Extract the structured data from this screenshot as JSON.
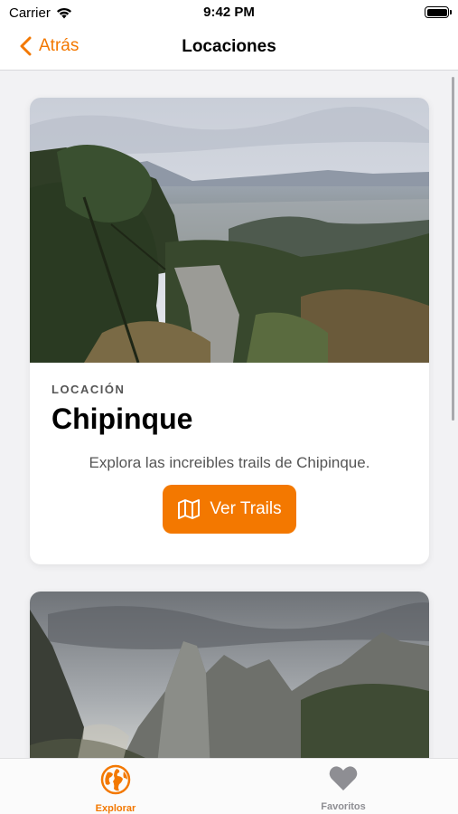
{
  "status_bar": {
    "carrier": "Carrier",
    "time": "9:42 PM"
  },
  "nav": {
    "back_label": "Atrás",
    "title": "Locaciones"
  },
  "cards": [
    {
      "eyebrow": "LOCACIÓN",
      "title": "Chipinque",
      "description": "Explora las increibles trails de Chipinque.",
      "button_label": "Ver Trails",
      "button_icon": "map-icon",
      "image": "mountain-forest-city-view-photo"
    },
    {
      "image": "rocky-mountain-peaks-photo"
    }
  ],
  "tab_bar": {
    "items": [
      {
        "label": "Explorar",
        "icon": "globe-icon",
        "active": true
      },
      {
        "label": "Favoritos",
        "icon": "heart-icon",
        "active": false
      }
    ]
  },
  "colors": {
    "accent": "#f37800",
    "inactive": "#8e8e93"
  }
}
